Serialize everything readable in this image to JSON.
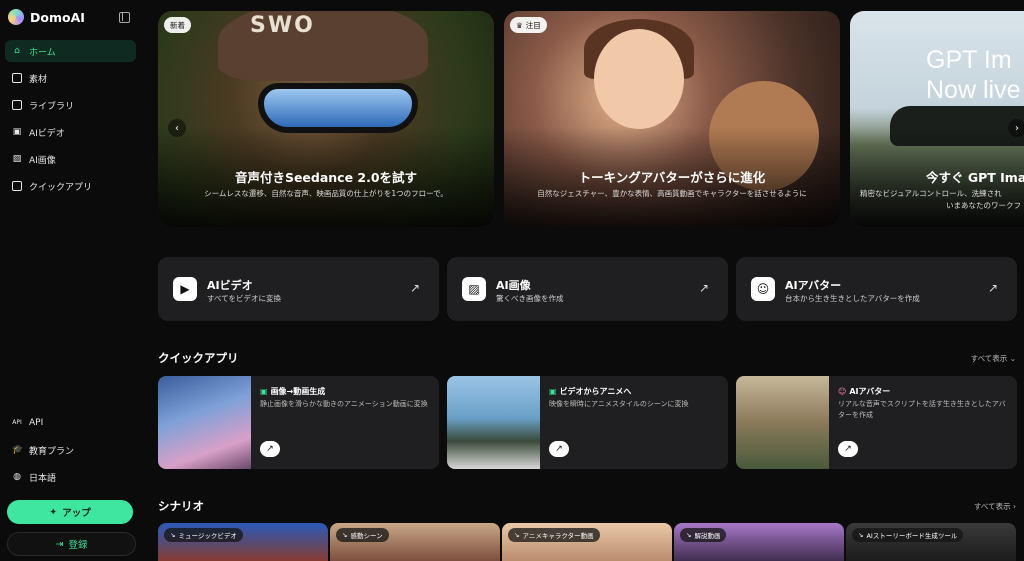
{
  "brand": {
    "name": "DomoAI"
  },
  "sidebar": {
    "items": [
      {
        "label": "ホーム",
        "icon": "home-icon",
        "active": true
      },
      {
        "label": "素材",
        "icon": "assets-icon"
      },
      {
        "label": "ライブラリ",
        "icon": "library-icon"
      },
      {
        "label": "AIビデオ",
        "icon": "video-icon"
      },
      {
        "label": "AI画像",
        "icon": "image-icon"
      },
      {
        "label": "クイックアプリ",
        "icon": "quick-app-icon"
      }
    ],
    "bottom": [
      {
        "label": "API",
        "icon": "api-icon"
      },
      {
        "label": "教育プラン",
        "icon": "education-icon"
      },
      {
        "label": "日本語",
        "icon": "globe-icon"
      }
    ],
    "app_button": "アップ",
    "login_button": "登録"
  },
  "banners": [
    {
      "tag": "新着",
      "title": "音声付きSeedance 2.0を試す",
      "desc": "シームレスな遷移、自然な音声、映画品質の仕上がりを1つのフローで。",
      "hat_text": "SWO"
    },
    {
      "tag": "注目",
      "title": "トーキングアバターがさらに進化",
      "desc": "自然なジェスチャー、豊かな表情、高画質動画でキャラクターを話させるように"
    },
    {
      "tag": "",
      "big_line1": "GPT Im",
      "big_line2": "Now live or",
      "title": "今すぐ GPT Ima",
      "desc": "精密なビジュアルコントロール、洗練され",
      "desc2": "いまあなたのワークフ"
    }
  ],
  "features": [
    {
      "title": "AIビデオ",
      "desc": "すべてをビデオに変換",
      "icon": "video-icon"
    },
    {
      "title": "AI画像",
      "desc": "驚くべき画像を作成",
      "icon": "image-icon"
    },
    {
      "title": "AIアバター",
      "desc": "台本から生き生きとしたアバターを作成",
      "icon": "avatar-icon"
    }
  ],
  "quick_apps": {
    "title": "クイックアプリ",
    "more": "すべて表示",
    "items": [
      {
        "title": "画像→動画生成",
        "desc": "静止画像を滑らかな動きのアニメーション動画に変換"
      },
      {
        "title": "ビデオからアニメへ",
        "desc": "映像を瞬時にアニメスタイルのシーンに変換"
      },
      {
        "title": "AIアバター",
        "desc": "リアルな音声でスクリプトを話す生き生きとしたアバターを作成"
      }
    ]
  },
  "scenarios": {
    "title": "シナリオ",
    "more": "すべて表示",
    "items": [
      "ミュージックビデオ",
      "感動シーン",
      "アニメキャラクター動画",
      "解説動画",
      "AIストーリーボード生成ツール"
    ]
  },
  "colors": {
    "accent": "#3ee6a0",
    "card": "#1f1f21",
    "bg": "#0b0b0c"
  }
}
